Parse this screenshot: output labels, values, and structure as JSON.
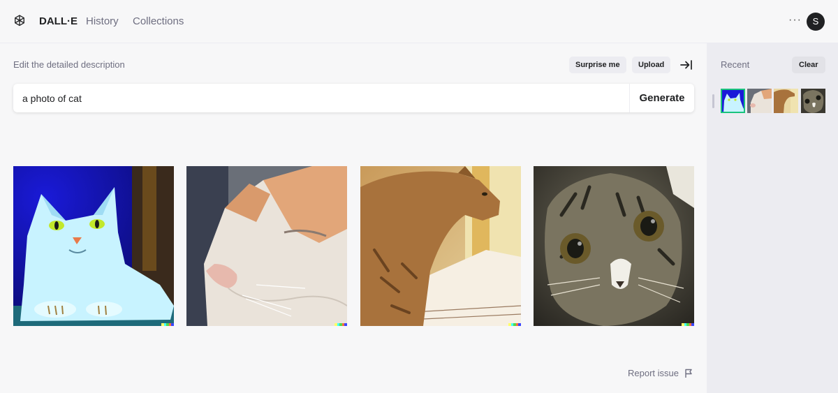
{
  "header": {
    "brand": "DALL·E",
    "nav": [
      {
        "label": "History"
      },
      {
        "label": "Collections"
      }
    ],
    "more_label": "···",
    "avatar_initial": "S"
  },
  "editor": {
    "label": "Edit the detailed description",
    "surprise_label": "Surprise me",
    "upload_label": "Upload",
    "prompt_value": "a photo of cat",
    "generate_label": "Generate"
  },
  "results": {
    "images": [
      {
        "subject": "blue tinted cat lying down"
      },
      {
        "subject": "close-up white and orange cat face"
      },
      {
        "subject": "tabby cat standing in sunlight"
      },
      {
        "subject": "tabby kitten close-up"
      }
    ],
    "report_label": "Report issue"
  },
  "sidebar": {
    "recent_label": "Recent",
    "clear_label": "Clear",
    "thumbnails": [
      {
        "subject": "blue tinted cat"
      },
      {
        "subject": "white cat face"
      },
      {
        "subject": "orange tabby cat"
      },
      {
        "subject": "tabby kitten"
      }
    ]
  },
  "colors": {
    "background": "#f7f7f8",
    "sidebar": "#ececf1",
    "text": "#202123",
    "muted": "#6e6e80",
    "signature": [
      "#ffff66",
      "#42ffff",
      "#51da4c",
      "#ff6e3c",
      "#3c46ff"
    ]
  }
}
